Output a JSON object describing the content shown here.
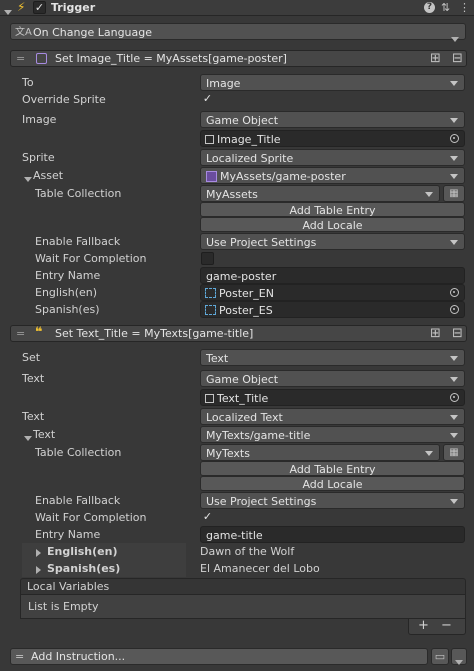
{
  "component": {
    "title": "Trigger",
    "checked": "✓"
  },
  "trigger_event": {
    "label": "On Change Language"
  },
  "instruction1": {
    "title": "Set Image_Title = MyAssets[game-poster]",
    "to_label": "To",
    "to_value": "Image",
    "override_label": "Override Sprite",
    "override_checked": "✓",
    "image_label": "Image",
    "image_mode": "Game Object",
    "image_object": "Image_Title",
    "sprite_label": "Sprite",
    "sprite_value": "Localized Sprite",
    "asset_label": "Asset",
    "asset_value": "MyAssets/game-poster",
    "table_collection_label": "Table Collection",
    "table_collection_value": "MyAssets",
    "add_table_entry": "Add Table Entry",
    "add_locale": "Add Locale",
    "fallback_label": "Enable Fallback",
    "fallback_value": "Use Project Settings",
    "wait_label": "Wait For Completion",
    "entry_name_label": "Entry Name",
    "entry_name_value": "game-poster",
    "english_label": "English(en)",
    "english_value": "Poster_EN",
    "spanish_label": "Spanish(es)",
    "spanish_value": "Poster_ES"
  },
  "instruction2": {
    "title": "Set Text_Title = MyTexts[game-title]",
    "set_label": "Set",
    "set_value": "Text",
    "text_label": "Text",
    "text_mode": "Game Object",
    "text_object": "Text_Title",
    "text2_label": "Text",
    "text2_value": "Localized Text",
    "text3_label": "Text",
    "text3_value": "MyTexts/game-title",
    "table_collection_label": "Table Collection",
    "table_collection_value": "MyTexts",
    "add_table_entry": "Add Table Entry",
    "add_locale": "Add Locale",
    "fallback_label": "Enable Fallback",
    "fallback_value": "Use Project Settings",
    "wait_label": "Wait For Completion",
    "wait_checked": "✓",
    "entry_name_label": "Entry Name",
    "entry_name_value": "game-title",
    "english_label": "English(en)",
    "english_value": "Dawn of the Wolf",
    "spanish_label": "Spanish(es)",
    "spanish_value": "El Amanecer del Lobo"
  },
  "local_variables": {
    "title": "Local Variables",
    "empty_text": "List is Empty",
    "add": "+",
    "remove": "−"
  },
  "footer": {
    "add_instruction": "Add Instruction..."
  }
}
